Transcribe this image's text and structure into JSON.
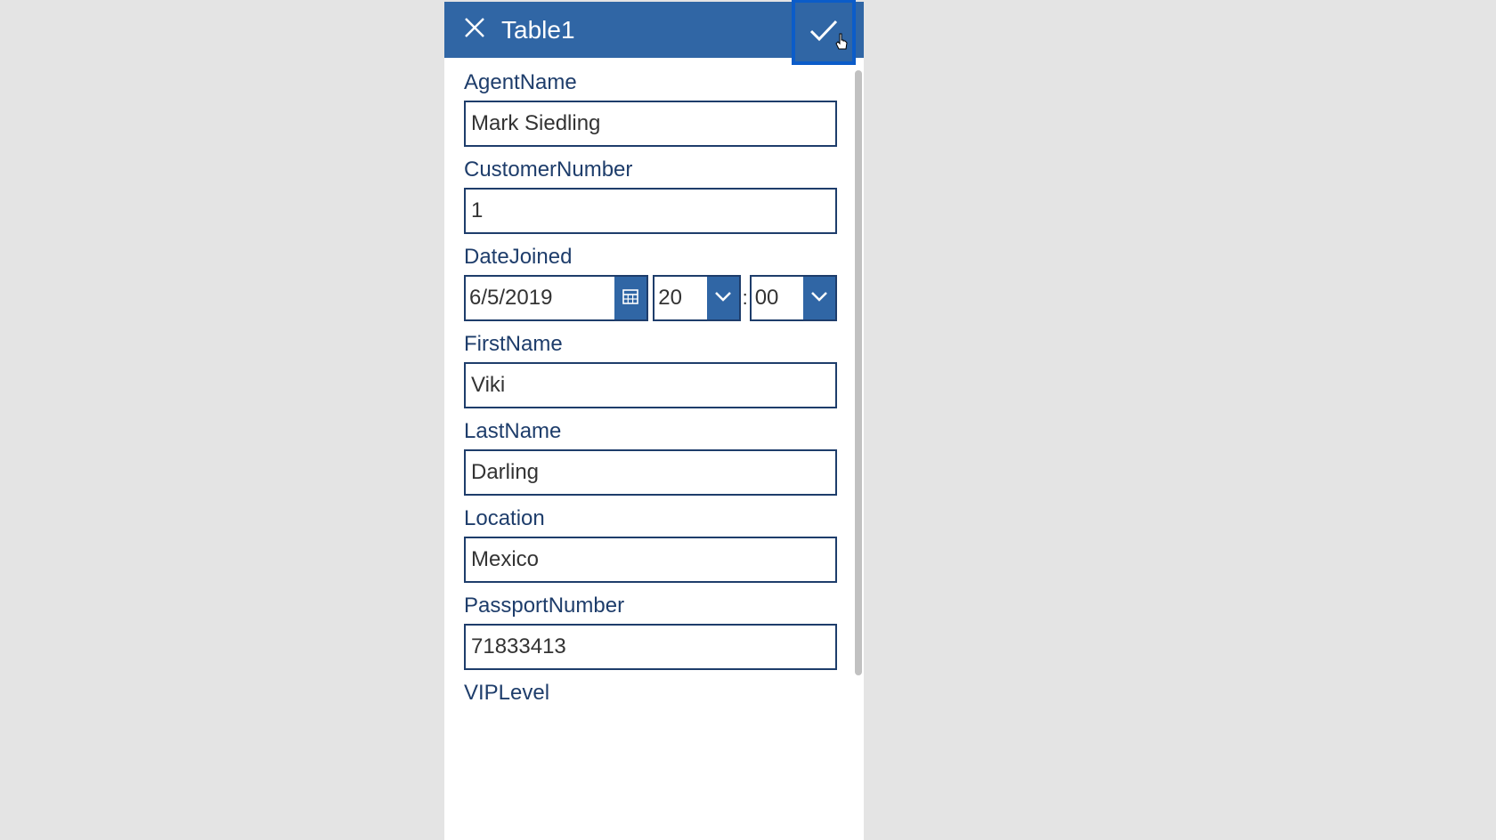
{
  "header": {
    "title": "Table1"
  },
  "fields": {
    "agentName": {
      "label": "AgentName",
      "value": "Mark Siedling"
    },
    "customerNumber": {
      "label": "CustomerNumber",
      "value": "1"
    },
    "dateJoined": {
      "label": "DateJoined",
      "date": "6/5/2019",
      "hour": "20",
      "minute": "00"
    },
    "firstName": {
      "label": "FirstName",
      "value": "Viki"
    },
    "lastName": {
      "label": "LastName",
      "value": "Darling"
    },
    "location": {
      "label": "Location",
      "value": "Mexico"
    },
    "passportNumber": {
      "label": "PassportNumber",
      "value": "71833413"
    },
    "vipLevel": {
      "label": "VIPLevel"
    }
  },
  "timeSeparator": ":"
}
